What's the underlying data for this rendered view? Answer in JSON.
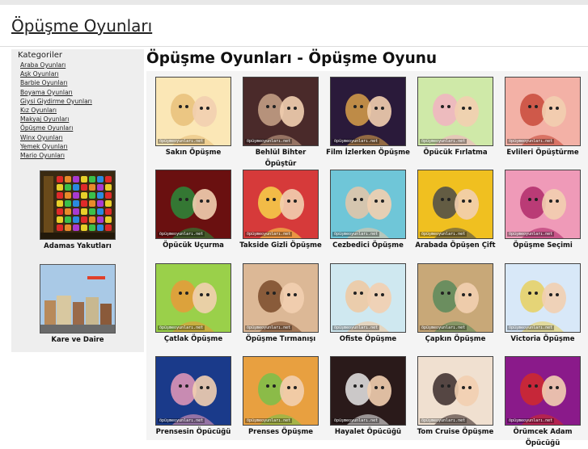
{
  "site_title": "Öpüşme Oyunları",
  "sidebar": {
    "title": "Kategoriler",
    "categories": [
      "Araba Oyunları",
      "Aşk Oyunları",
      "Barbie Oyunları",
      "Boyama Oyunları",
      "Giysi Giydirme Oyunları",
      "Kız Oyunları",
      "Makyaj Oyunları",
      "Öpüşme Oyunları",
      "Winx Oyunları",
      "Yemek Oyunları",
      "Mario Oyunları"
    ],
    "featured": [
      {
        "label": "Adamas Yakutları",
        "colors": [
          "#3a2a12",
          "#7a5a22"
        ]
      },
      {
        "label": "Kare ve Daire",
        "colors": [
          "#a9c9e6",
          "#8a7a5a"
        ]
      }
    ]
  },
  "page_heading": "Öpüşme Oyunları - Öpüşme Oyunu",
  "games": [
    {
      "label": "Sakın Öpüşme",
      "colors": [
        "#fbe7b6",
        "#e8c07a"
      ]
    },
    {
      "label": "Behlül Bihter Öpüştür",
      "colors": [
        "#4a2a2a",
        "#c9a58a"
      ]
    },
    {
      "label": "Film İzlerken Öpüşme",
      "colors": [
        "#2a1a3a",
        "#d8a04a"
      ]
    },
    {
      "label": "Öpücük Fırlatma",
      "colors": [
        "#cfe9a8",
        "#f2b3c2"
      ]
    },
    {
      "label": "Evlileri Öpüştürme",
      "colors": [
        "#f3b1a6",
        "#c84a3a"
      ]
    },
    {
      "label": "Öpücük Uçurma",
      "colors": [
        "#6a1010",
        "#2a8a3a"
      ]
    },
    {
      "label": "Takside Gizli Öpüşme",
      "colors": [
        "#d63a3a",
        "#f7d24a"
      ]
    },
    {
      "label": "Cezbedici Öpüşme",
      "colors": [
        "#6fc6d8",
        "#e8c6a8"
      ]
    },
    {
      "label": "Arabada Öpüşen Çift",
      "colors": [
        "#f0c020",
        "#4a4a4a"
      ]
    },
    {
      "label": "Öpüşme Seçimi",
      "colors": [
        "#ef9ab8",
        "#b02a6a"
      ]
    },
    {
      "label": "Çatlak Öpüşme",
      "colors": [
        "#9ad04a",
        "#e89a3a"
      ]
    },
    {
      "label": "Öpüşme Tırmanışı",
      "colors": [
        "#dcb896",
        "#7a4a2a"
      ]
    },
    {
      "label": "Ofiste Öpüşme",
      "colors": [
        "#cfe8f0",
        "#f0c8a0"
      ]
    },
    {
      "label": "Çapkın Öpüşme",
      "colors": [
        "#c8a878",
        "#5a8a5a"
      ]
    },
    {
      "label": "Victoria Öpüşme",
      "colors": [
        "#d8e8f8",
        "#e8d060"
      ]
    },
    {
      "label": "Prensesin Öpücüğü",
      "colors": [
        "#1a3a8a",
        "#e89ab8"
      ]
    },
    {
      "label": "Prenses Öpüşme",
      "colors": [
        "#e8a040",
        "#7ac04a"
      ]
    },
    {
      "label": "Hayalet Öpücüğü",
      "colors": [
        "#2a1a1a",
        "#e8e8e8"
      ]
    },
    {
      "label": "Tom Cruise Öpüşme",
      "colors": [
        "#f0e0d0",
        "#3a2a2a"
      ]
    },
    {
      "label": "Örümcek Adam Öpücüğü",
      "colors": [
        "#8a1a8a",
        "#d02a2a"
      ]
    }
  ],
  "watermark": "öpüşmeoyunları.net"
}
